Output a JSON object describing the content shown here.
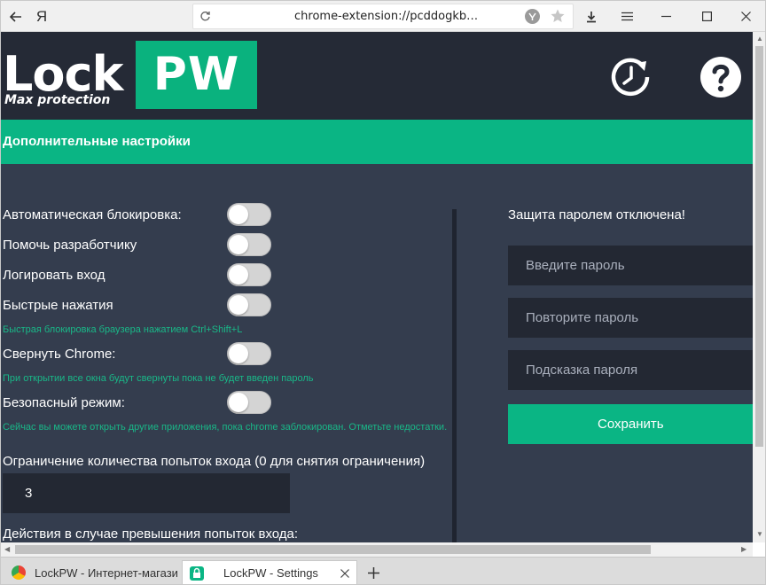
{
  "browser": {
    "url": "chrome-extension://pcddogkb…",
    "yandex_label": "Я"
  },
  "header": {
    "logo_lock": "Lock",
    "logo_pw": "PW",
    "logo_sub": "Max protection"
  },
  "section": {
    "title": "Дополнительные настройки"
  },
  "settings": [
    {
      "label": "Автоматическая блокировка:",
      "hint": ""
    },
    {
      "label": "Помочь разработчику",
      "hint": ""
    },
    {
      "label": "Логировать вход",
      "hint": ""
    },
    {
      "label": "Быстрые нажатия",
      "hint": "Быстрая блокировка браузера нажатием Ctrl+Shift+L"
    },
    {
      "label": "Свернуть Chrome:",
      "hint": "При открытии все окна будут свернуты пока не будет введен пароль"
    },
    {
      "label": "Безопасный режим:",
      "hint": "Сейчас вы можете открыть другие приложения, пока chrome заблокирован. Отметьте недостатки."
    }
  ],
  "limit": {
    "label": "Ограничение количества попыток входа (0 для снятия ограничения)",
    "value": "3"
  },
  "actions_label": "Действия в случае превышения попыток входа:",
  "password": {
    "status": "Защита паролем отключена!",
    "enter_placeholder": "Введите пароль",
    "repeat_placeholder": "Повторите пароль",
    "hint_placeholder": "Подсказка пароля",
    "save_label": "Сохранить"
  },
  "tabs": [
    {
      "label": "LockPW - Интернет-магазин"
    },
    {
      "label": "LockPW - Settings"
    }
  ],
  "colors": {
    "accent": "#0ab584",
    "header_bg": "#252a36",
    "page_bg": "#343d4e",
    "input_bg": "#232833"
  }
}
